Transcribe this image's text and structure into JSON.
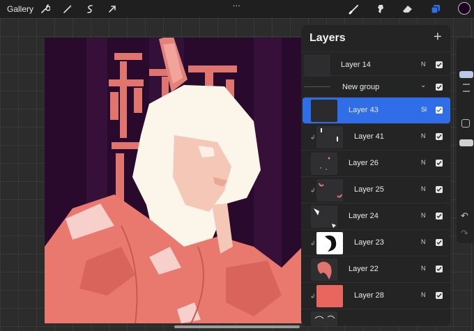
{
  "topbar": {
    "gallery_label": "Gallery",
    "left_icons": [
      "wrench-icon",
      "magic-wand-icon",
      "selection-icon",
      "transform-arrow-icon"
    ],
    "right_icons": [
      "brush-icon",
      "smudge-icon",
      "eraser-icon",
      "layers-icon"
    ],
    "active_color": "#1c0420",
    "accent": "#2f6ee8"
  },
  "layers_panel": {
    "title": "Layers",
    "add_label": "+",
    "layers": [
      {
        "name": "Layer 14",
        "blend": "N",
        "visible": true,
        "clipped": false,
        "selected": false,
        "group": false
      },
      {
        "name": "New group",
        "blend": "",
        "visible": true,
        "clipped": false,
        "selected": false,
        "group": true
      },
      {
        "name": "Layer 43",
        "blend": "Sl",
        "visible": true,
        "clipped": false,
        "selected": true,
        "group": false
      },
      {
        "name": "Layer 41",
        "blend": "N",
        "visible": true,
        "clipped": true,
        "selected": false,
        "group": false
      },
      {
        "name": "Layer 26",
        "blend": "N",
        "visible": true,
        "clipped": false,
        "selected": false,
        "group": false
      },
      {
        "name": "Layer 25",
        "blend": "N",
        "visible": true,
        "clipped": true,
        "selected": false,
        "group": false
      },
      {
        "name": "Layer 24",
        "blend": "N",
        "visible": true,
        "clipped": false,
        "selected": false,
        "group": false
      },
      {
        "name": "Layer 23",
        "blend": "N",
        "visible": true,
        "clipped": true,
        "selected": false,
        "group": false
      },
      {
        "name": "Layer 22",
        "blend": "N",
        "visible": true,
        "clipped": false,
        "selected": false,
        "group": false
      },
      {
        "name": "Layer 28",
        "blend": "N",
        "visible": true,
        "clipped": true,
        "selected": false,
        "group": false
      }
    ]
  },
  "sidebar": {
    "undo_icon": "undo-icon",
    "redo_icon": "redo-icon"
  }
}
